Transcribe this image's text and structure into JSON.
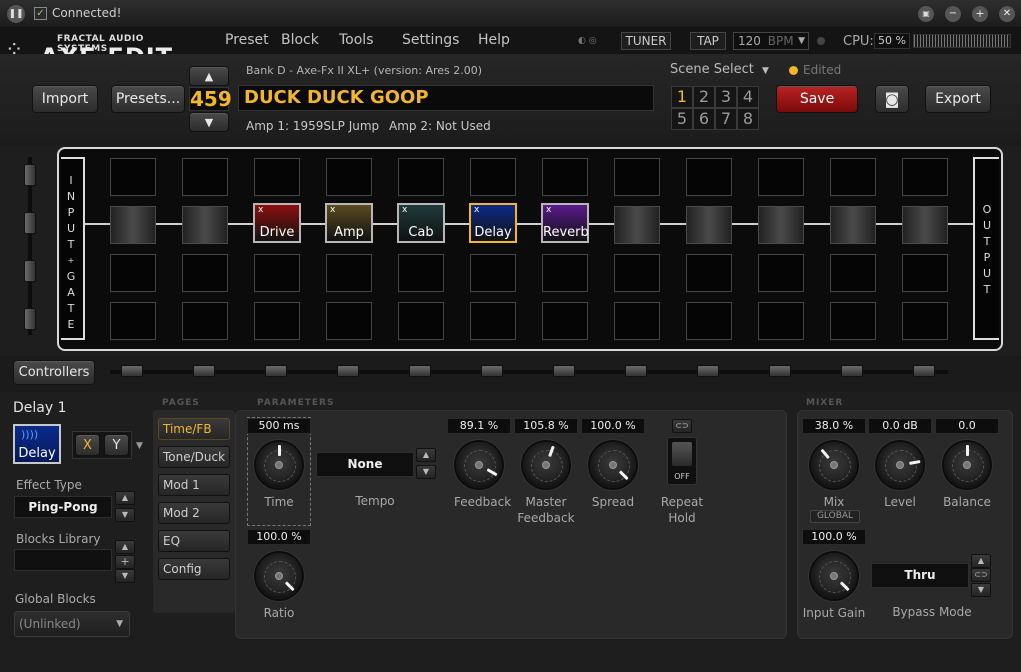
{
  "titlebar": {
    "status": "Connected!"
  },
  "brand": {
    "company": "FRACTAL AUDIO SYSTEMS",
    "app": "AXE-EDIT"
  },
  "menu": [
    "Preset",
    "Block",
    "Tools",
    "Settings",
    "Help"
  ],
  "toolbar": {
    "tuner": "TUNER",
    "tap": "TAP",
    "bpm": "120",
    "bpm_unit": "BPM",
    "cpu_label": "CPU:",
    "cpu_value": "50 %"
  },
  "preset": {
    "bank_info": "Bank D - Axe-Fx II XL+ (version: Ares 2.00)",
    "number": "459",
    "name": "DUCK DUCK GOOP",
    "amp1": "Amp 1: 1959SLP Jump",
    "amp2": "Amp 2: Not Used",
    "import_label": "Import",
    "presets_label": "Presets...",
    "scene_select": "Scene Select",
    "edited": "Edited",
    "scenes": [
      "1",
      "2",
      "3",
      "4",
      "5",
      "6",
      "7",
      "8"
    ],
    "active_scene": "1",
    "save_label": "Save",
    "export_label": "Export"
  },
  "grid": {
    "input_label": [
      "I",
      "N",
      "P",
      "U",
      "T",
      "+",
      "G",
      "A",
      "T",
      "E"
    ],
    "output_label": [
      "O",
      "U",
      "T",
      "P",
      "U",
      "T"
    ],
    "blocks": [
      {
        "name": "Drive",
        "color": "#8b1010"
      },
      {
        "name": "Amp",
        "color": "#5a4a20"
      },
      {
        "name": "Cab",
        "color": "#1f3a3a"
      },
      {
        "name": "Delay",
        "color": "#0b2a8a"
      },
      {
        "name": "Reverb",
        "color": "#5a1a8a"
      }
    ]
  },
  "controllers_label": "Controllers",
  "block_panel": {
    "title": "Delay 1",
    "icon_label": "Delay",
    "x_label": "X",
    "y_label": "Y",
    "effect_type_label": "Effect Type",
    "effect_type": "Ping-Pong",
    "library_label": "Blocks Library",
    "global_label": "Global Blocks",
    "global_value": "(Unlinked)"
  },
  "sections": {
    "pages": "PAGES",
    "parameters": "PARAMETERS",
    "mixer": "MIXER"
  },
  "pages": [
    "Time/FB",
    "Tone/Duck",
    "Mod 1",
    "Mod 2",
    "EQ",
    "Config"
  ],
  "active_page": "Time/FB",
  "params": [
    {
      "label": "Time",
      "value": "500 ms",
      "angle": 0
    },
    {
      "label": "Feedback",
      "value": "89.1 %",
      "angle": 120
    },
    {
      "label": "Master Feedback",
      "value": "105.8 %",
      "angle": 20
    },
    {
      "label": "Spread",
      "value": "100.0 %",
      "angle": 135
    },
    {
      "label": "Ratio",
      "value": "100.0 %",
      "angle": 135
    }
  ],
  "tempo": {
    "label": "Tempo",
    "value": "None"
  },
  "repeat_hold": {
    "label": "Repeat Hold",
    "state": "OFF"
  },
  "mixer": [
    {
      "label": "Mix",
      "value": "38.0 %",
      "angle": -40
    },
    {
      "label": "Level",
      "value": "0.0 dB",
      "angle": 80
    },
    {
      "label": "Balance",
      "value": "0.0",
      "angle": 0
    },
    {
      "label": "Input Gain",
      "value": "100.0 %",
      "angle": 135
    }
  ],
  "global_badge": "GLOBAL",
  "bypass": {
    "label": "Bypass Mode",
    "value": "Thru"
  }
}
